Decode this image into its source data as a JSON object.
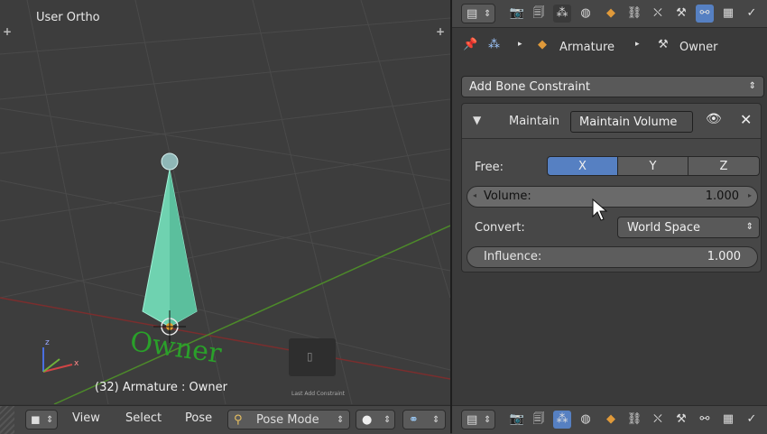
{
  "viewport": {
    "title": "User Ortho",
    "status": "(32) Armature : Owner",
    "owner_label": "Owner",
    "overlay_caption": "Last Add Constraint"
  },
  "viewport_header": {
    "menus": [
      "View",
      "Select",
      "Pose"
    ],
    "mode": "Pose Mode"
  },
  "breadcrumb": {
    "object": "Armature",
    "bone": "Owner"
  },
  "add_constraint": "Add Bone Constraint",
  "constraint": {
    "type_label": "Maintain",
    "name": "Maintain Volume",
    "free_label": "Free:",
    "axes": [
      "X",
      "Y",
      "Z"
    ],
    "active_axis": "X",
    "volume_label": "Volume:",
    "volume_value": "1.000",
    "convert_label": "Convert:",
    "convert_value": "World Space",
    "influence_label": "Influence:",
    "influence_value": "1.000"
  },
  "colors": {
    "active_toggle": "#5680c2",
    "bone": "#6fd2b0",
    "owner_text": "#2aa02a",
    "grid_x_axis": "#8a2b2b",
    "grid_y_axis": "#4d8a2a"
  }
}
